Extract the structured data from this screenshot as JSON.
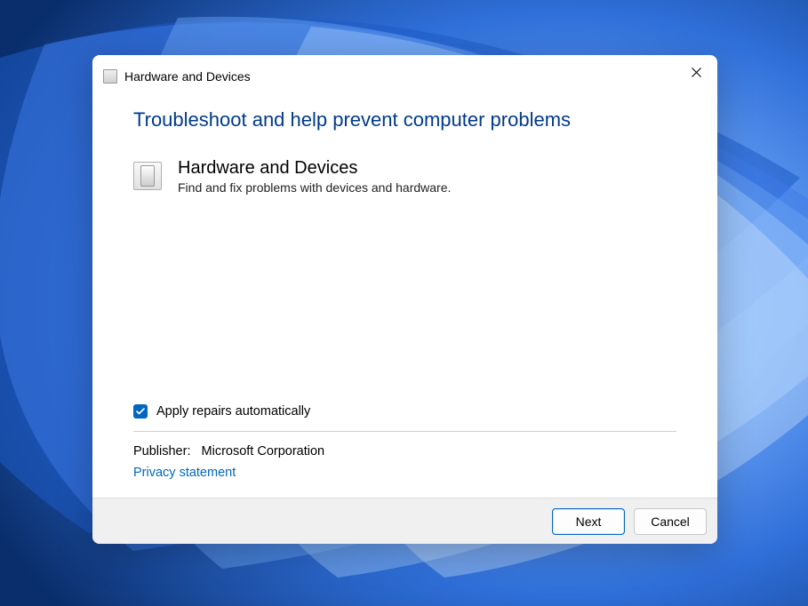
{
  "window": {
    "title": "Hardware and Devices"
  },
  "headline": "Troubleshoot and help prevent computer problems",
  "item": {
    "title": "Hardware and Devices",
    "description": "Find and fix problems with devices and hardware."
  },
  "options": {
    "apply_repairs_label": "Apply repairs automatically",
    "apply_repairs_checked": true
  },
  "publisher": {
    "label": "Publisher:",
    "value": "Microsoft Corporation"
  },
  "privacy_link": "Privacy statement",
  "buttons": {
    "next": "Next",
    "cancel": "Cancel"
  }
}
